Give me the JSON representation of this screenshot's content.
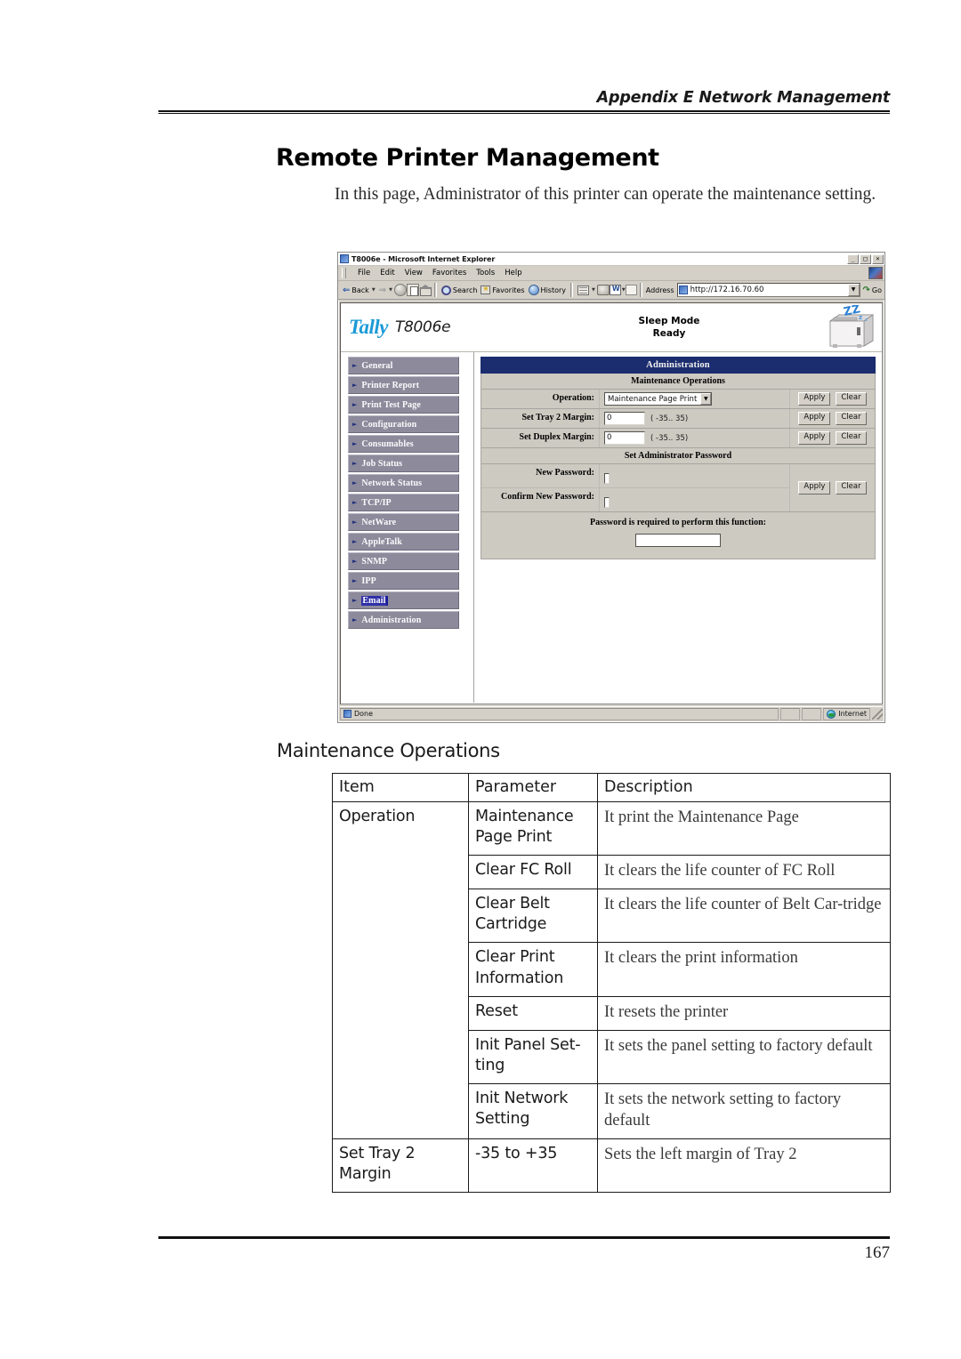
{
  "page": {
    "running_head": "Appendix E Network Management",
    "title": "Remote Printer Management",
    "intro": "In this page, Administrator of this printer can operate the maintenance setting.",
    "section_heading": "Maintenance Operations",
    "page_number": "167"
  },
  "browser": {
    "window_title": "T8006e - Microsoft Internet Explorer",
    "window_buttons": {
      "minimize": "_",
      "maximize": "□",
      "close": "×"
    },
    "menus": [
      "File",
      "Edit",
      "View",
      "Favorites",
      "Tools",
      "Help"
    ],
    "toolbar": {
      "back": "Back",
      "forward": "",
      "search": "Search",
      "favorites": "Favorites",
      "history": "History",
      "address_label": "Address",
      "address_value": "http://172.16.70.60",
      "go": "Go"
    },
    "status": {
      "text": "Done",
      "zone": "Internet"
    }
  },
  "printer_ui": {
    "brand": "Tally",
    "model": "T8006e",
    "status_line1": "Sleep Mode",
    "status_line2": "Ready",
    "nav_items": [
      {
        "label": "General",
        "selected": false
      },
      {
        "label": "Printer Report",
        "selected": false
      },
      {
        "label": "Print Test Page",
        "selected": false
      },
      {
        "label": "Configuration",
        "selected": false
      },
      {
        "label": "Consumables",
        "selected": false
      },
      {
        "label": "Job Status",
        "selected": false
      },
      {
        "label": "Network Status",
        "selected": false
      },
      {
        "label": "TCP/IP",
        "selected": false
      },
      {
        "label": "NetWare",
        "selected": false
      },
      {
        "label": "AppleTalk",
        "selected": false
      },
      {
        "label": "SNMP",
        "selected": false
      },
      {
        "label": "IPP",
        "selected": false
      },
      {
        "label": "Email",
        "selected": true
      },
      {
        "label": "Administration",
        "selected": false
      }
    ],
    "panel_title": "Administration",
    "section_maintenance": "Maintenance Operations",
    "fields": {
      "operation_label": "Operation:",
      "operation_value": "Maintenance Page Print",
      "tray2_label": "Set Tray 2 Margin:",
      "tray2_value": "0",
      "tray2_hint": "( -35.. 35)",
      "duplex_label": "Set Duplex Margin:",
      "duplex_value": "0",
      "duplex_hint": "( -35.. 35)",
      "apply": "Apply",
      "clear": "Clear"
    },
    "section_password": "Set Administrator Password",
    "password": {
      "new_label": "New Password:",
      "new_value": "",
      "confirm_label": "Confirm New Password:",
      "confirm_value": "",
      "note": "Password is required to perform this function:",
      "note_value": ""
    },
    "colors": {
      "banner": "#1b2d6e",
      "nav_bg": "#8d8a9c",
      "panel_bg": "#cdcac2",
      "brand": "#1b9ad6",
      "selection": "#2f2fa8"
    }
  },
  "table": {
    "headers": [
      "Item",
      "Parameter",
      "Description"
    ],
    "rows": [
      {
        "item": "Operation",
        "param": "Maintenance Page Print",
        "desc": "It print the Maintenance Page"
      },
      {
        "item": "",
        "param": "Clear FC Roll",
        "desc": "It clears the life counter of FC Roll"
      },
      {
        "item": "",
        "param": "Clear Belt Cartridge",
        "desc": "It clears the life counter of Belt Car-tridge"
      },
      {
        "item": "",
        "param": "Clear Print Information",
        "desc": "It clears the print information"
      },
      {
        "item": "",
        "param": "Reset",
        "desc": "It resets the printer"
      },
      {
        "item": "",
        "param": "Init Panel Set-ting",
        "desc": "It sets the panel setting to factory default"
      },
      {
        "item": "",
        "param": "Init Network Setting",
        "desc": "It sets the network setting to factory default"
      },
      {
        "item": "Set Tray 2 Margin",
        "param": "-35 to +35",
        "desc": "Sets the left margin of Tray 2"
      }
    ]
  }
}
